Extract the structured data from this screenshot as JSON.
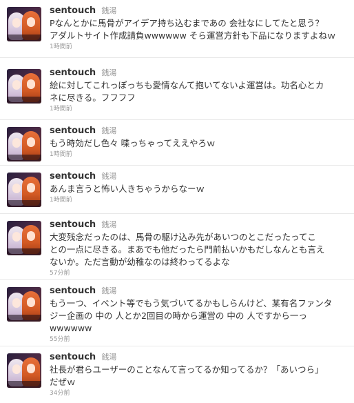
{
  "tweets": [
    {
      "screen_name": "sentouch",
      "full_name": "銭湯",
      "lines": [
        "Pなんとかに馬骨がアイデア持ち込むまであの 会社なにしてたと思う？",
        "アダルトサイト作成請負wwwwww そら運営方針も下品になりますよねｗ"
      ],
      "time": "1時間前"
    },
    {
      "screen_name": "sentouch",
      "full_name": "銭湯",
      "lines": [
        "絵に対してこれっぽっちも愛情なんて抱いてないよ運営は。功名心とカ",
        "ネに尽きる。フフフフ"
      ],
      "time": "1時間前"
    },
    {
      "screen_name": "sentouch",
      "full_name": "銭湯",
      "lines": [
        "もう時効だし色々 喋っちゃってええやろｗ"
      ],
      "time": "1時間前"
    },
    {
      "screen_name": "sentouch",
      "full_name": "銭湯",
      "lines": [
        "あんま言うと怖い人きちゃうからなーｗ"
      ],
      "time": "1時間前"
    },
    {
      "screen_name": "sentouch",
      "full_name": "銭湯",
      "lines": [
        "大変残念だったのは、馬骨の駆け込み先があいつのとこだったってこ",
        "との一点に尽きる。まあでも他だったら門前払いかもだしなんとも言え",
        "ないか。ただ言動が幼稚なのは終わってるよな"
      ],
      "time": "57分前"
    },
    {
      "screen_name": "sentouch",
      "full_name": "銭湯",
      "lines": [
        "もう一つ、イベント等でもう気づいてるかもしらんけど、某有名ファンタ",
        "ジー企画の 中の 人とか2回目の時から運営の 中の 人ですから一っ",
        "wwwwww"
      ],
      "time": "55分前"
    },
    {
      "screen_name": "sentouch",
      "full_name": "銭湯",
      "lines": [
        "社長が君らユーザーのことなんて言ってるか知ってるか？「あいつら」",
        "だぜｗ"
      ],
      "time": "34分前"
    }
  ]
}
